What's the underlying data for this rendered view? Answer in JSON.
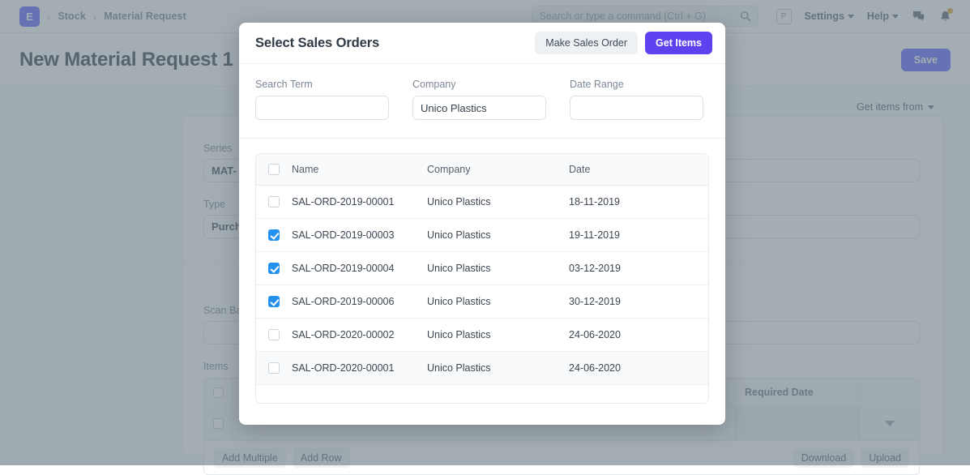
{
  "navbar": {
    "logo_letter": "E",
    "breadcrumbs": [
      "Stock",
      "Material Request"
    ],
    "search_placeholder": "Search or type a command (Ctrl + G)",
    "search_value": "",
    "avatar_letter": "P",
    "settings_label": "Settings",
    "help_label": "Help"
  },
  "page": {
    "title": "New Material Request 1",
    "save_label": "Save",
    "get_items_from_label": "Get items from"
  },
  "form": {
    "series_label": "Series",
    "series_value": "MAT-",
    "type_label": "Type",
    "type_value": "Purch",
    "scan_label": "Scan Ba",
    "scan_value": "",
    "items_label": "Items",
    "required_date_header": "Required Date",
    "add_multiple_label": "Add Multiple",
    "add_row_label": "Add Row",
    "download_label": "Download",
    "upload_label": "Upload"
  },
  "modal": {
    "title": "Select Sales Orders",
    "make_sales_order_label": "Make Sales Order",
    "get_items_label": "Get Items",
    "filters": [
      {
        "label": "Search Term",
        "value": "",
        "placeholder": ""
      },
      {
        "label": "Company",
        "value": "Unico Plastics",
        "placeholder": ""
      },
      {
        "label": "Date Range",
        "value": "",
        "placeholder": ""
      }
    ],
    "table": {
      "select_all_checked": false,
      "columns": [
        "Name",
        "Company",
        "Date"
      ],
      "rows": [
        {
          "checked": false,
          "name": "SAL-ORD-2019-00001",
          "company": "Unico Plastics",
          "date": "18-11-2019",
          "highlight": false
        },
        {
          "checked": true,
          "name": "SAL-ORD-2019-00003",
          "company": "Unico Plastics",
          "date": "19-11-2019",
          "highlight": false
        },
        {
          "checked": true,
          "name": "SAL-ORD-2019-00004",
          "company": "Unico Plastics",
          "date": "03-12-2019",
          "highlight": false
        },
        {
          "checked": true,
          "name": "SAL-ORD-2019-00006",
          "company": "Unico Plastics",
          "date": "30-12-2019",
          "highlight": false
        },
        {
          "checked": false,
          "name": "SAL-ORD-2020-00002",
          "company": "Unico Plastics",
          "date": "24-06-2020",
          "highlight": false
        },
        {
          "checked": false,
          "name": "SAL-ORD-2020-00001",
          "company": "Unico Plastics",
          "date": "24-06-2020",
          "highlight": true
        }
      ]
    }
  },
  "colors": {
    "brand_purple": "#5e64ff",
    "primary_button": "#5e42f0",
    "checkbox_blue": "#2490ef",
    "status_dot": "#cb9a19",
    "veil": "rgba(106,122,133,.62)"
  },
  "icons": {
    "search": "search-icon",
    "chat": "chat-icon",
    "bell": "bell-icon"
  }
}
